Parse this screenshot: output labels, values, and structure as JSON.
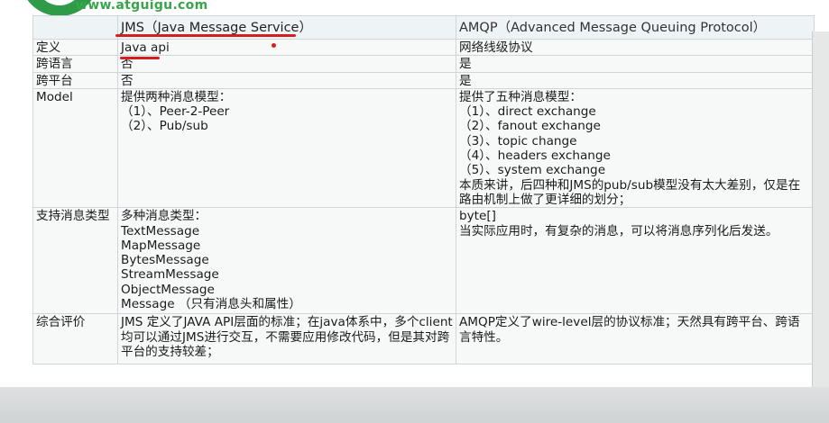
{
  "brand": {
    "url": "www.atguigu.com",
    "color": "#38a44d"
  },
  "table": {
    "header": {
      "col1": "",
      "col2": "JMS（Java Message Service）",
      "col3": "AMQP（Advanced Message Queuing Protocol）"
    },
    "rows": [
      {
        "label": "定义",
        "jms": [
          "Java api"
        ],
        "amqp": [
          "网络线级协议"
        ]
      },
      {
        "label": "跨语言",
        "jms": [
          "否"
        ],
        "amqp": [
          "是"
        ]
      },
      {
        "label": "跨平台",
        "jms": [
          "否"
        ],
        "amqp": [
          "是"
        ]
      },
      {
        "label": "Model",
        "jms": [
          "提供两种消息模型：",
          "（1）、Peer-2-Peer",
          "（2）、Pub/sub"
        ],
        "amqp": [
          "提供了五种消息模型：",
          "（1）、direct exchange",
          "（2）、fanout exchange",
          "（3）、topic change",
          "（4）、headers exchange",
          "（5）、system exchange",
          "本质来讲，后四种和JMS的pub/sub模型没有太大差别，仅是在",
          "路由机制上做了更详细的划分；"
        ]
      },
      {
        "label": "支持消息类型",
        "jms": [
          "多种消息类型：",
          "TextMessage",
          "MapMessage",
          "BytesMessage",
          "StreamMessage",
          "ObjectMessage",
          "Message （只有消息头和属性）"
        ],
        "amqp": [
          "byte[]",
          "当实际应用时，有复杂的消息，可以将消息序列化后发送。"
        ]
      },
      {
        "label": "综合评价",
        "jms": [
          "JMS 定义了JAVA API层面的标准；在java体系中，多个client",
          "均可以通过JMS进行交互，不需要应用修改代码，但是其对跨",
          "平台的支持较差；"
        ],
        "amqp": [
          "AMQP定义了wire-level层的协议标准；天然具有跨平台、跨语",
          "言特性。"
        ]
      }
    ]
  },
  "annotations": {
    "color": "#d51f1f"
  }
}
